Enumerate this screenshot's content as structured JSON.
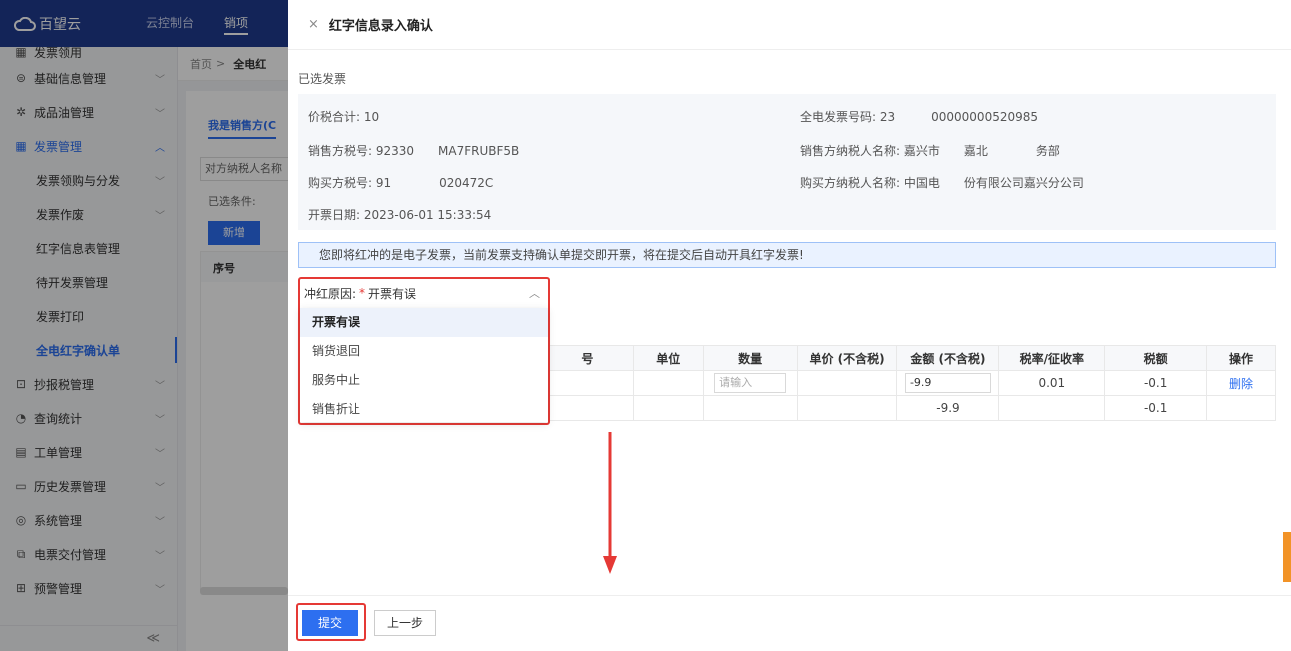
{
  "topbar": {
    "logo_text": "百望云",
    "nav": [
      "云控制台",
      "销项"
    ]
  },
  "sidebar": {
    "cut_item": "发票领用",
    "items": [
      {
        "label": "基础信息管理",
        "icon": "shield-icon",
        "chev": "﹀"
      },
      {
        "label": "成品油管理",
        "icon": "gear-icon",
        "chev": "﹀"
      },
      {
        "label": "发票管理",
        "icon": "grid-icon",
        "chev": "︿",
        "open": true
      },
      {
        "label": "发票领购与分发",
        "sub": true,
        "chev": "﹀"
      },
      {
        "label": "发票作废",
        "sub": true,
        "chev": "﹀"
      },
      {
        "label": "红字信息表管理",
        "sub": true
      },
      {
        "label": "待开发票管理",
        "sub": true
      },
      {
        "label": "发票打印",
        "sub": true
      },
      {
        "label": "全电红字确认单",
        "sub": true,
        "current": true
      },
      {
        "label": "抄报税管理",
        "icon": "tax-icon",
        "chev": "﹀"
      },
      {
        "label": "查询统计",
        "icon": "chart-icon",
        "chev": "﹀"
      },
      {
        "label": "工单管理",
        "icon": "ticket-icon",
        "chev": "﹀"
      },
      {
        "label": "历史发票管理",
        "icon": "history-icon",
        "chev": "﹀"
      },
      {
        "label": "系统管理",
        "icon": "settings-icon",
        "chev": "﹀"
      },
      {
        "label": "电票交付管理",
        "icon": "delivery-icon",
        "chev": "﹀"
      },
      {
        "label": "预警管理",
        "icon": "alert-icon",
        "chev": "﹀"
      }
    ],
    "collapse": "≪"
  },
  "bg": {
    "crumb_home": "首页",
    "crumb_sep": ">",
    "crumb_current": "全电红",
    "tab": "我是销售方(C",
    "filter": "对方纳税人名称",
    "cond": "已选条件:",
    "new_btn": "新增",
    "th": "序号"
  },
  "drawer": {
    "close": "×",
    "title": "红字信息录入确认",
    "selected_label": "已选发票",
    "info": {
      "total": "价税合计:  10",
      "invoice_no": "全电发票号码:  23   00000000520985",
      "seller_tax": "销售方税号:  92330  MA7FRUBF5B",
      "seller_name": "销售方纳税人名称:  嘉兴市  嘉北    务部",
      "buyer_tax": "购买方税号:  91    020472C",
      "buyer_name": "购买方纳税人名称:  中国电  份有限公司嘉兴分公司",
      "date": "开票日期:  2023-06-01 15:33:54"
    },
    "notice": "您即将红冲的是电子发票，当前发票支持确认单提交即开票，将在提交后自动开具红字发票!",
    "reason": {
      "label": "冲红原因:",
      "required": "*",
      "value": "开票有误",
      "options": [
        "开票有误",
        "销货退回",
        "服务中止",
        "销售折让"
      ]
    },
    "table": {
      "headers": [
        "号",
        "单位",
        "数量",
        "单价 (不含税)",
        "金额 (不含税)",
        "税率/征收率",
        "税额",
        "操作"
      ],
      "row": {
        "qty_placeholder": "请输入",
        "amount": "-9.9",
        "rate": "0.01",
        "tax": "-0.1",
        "action": "删除"
      },
      "total": {
        "amount": "-9.9",
        "tax": "-0.1"
      }
    },
    "footer": {
      "submit": "提交",
      "prev": "上一步"
    }
  },
  "colors": {
    "accent": "#2d6ff0",
    "highlight": "#e53935",
    "topbar": "#1f3b8f"
  }
}
